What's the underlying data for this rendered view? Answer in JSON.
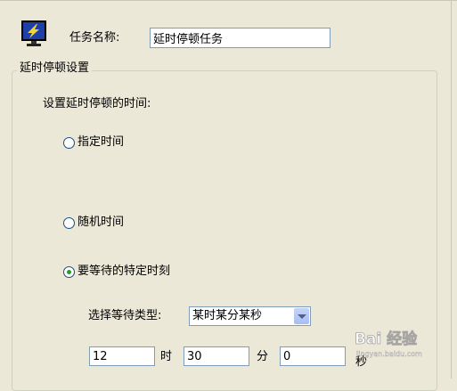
{
  "task": {
    "name_label": "任务名称:",
    "name_value": "延时停顿任务"
  },
  "group": {
    "title": "延时停顿设置",
    "prompt": "设置延时停顿的时间:",
    "options": [
      {
        "label": "指定时间",
        "checked": false
      },
      {
        "label": "随机时间",
        "checked": false
      },
      {
        "label": "要等待的特定时刻",
        "checked": true
      }
    ],
    "wait_type_label": "选择等待类型:",
    "wait_type_value": "某时某分某秒",
    "hour_value": "12",
    "hour_unit": "时",
    "minute_value": "30",
    "minute_unit": "分",
    "second_value": "0",
    "second_unit": "秒"
  },
  "colors": {
    "background": "#ebe8d8",
    "input_border": "#7f9db9",
    "radio_dot": "#21a121"
  },
  "icons": {
    "app": "monitor-with-lightning-icon",
    "dropdown": "chevron-down-icon"
  },
  "watermark": {
    "text": "Bai 经验",
    "sub": "jingyan.baidu.com"
  }
}
